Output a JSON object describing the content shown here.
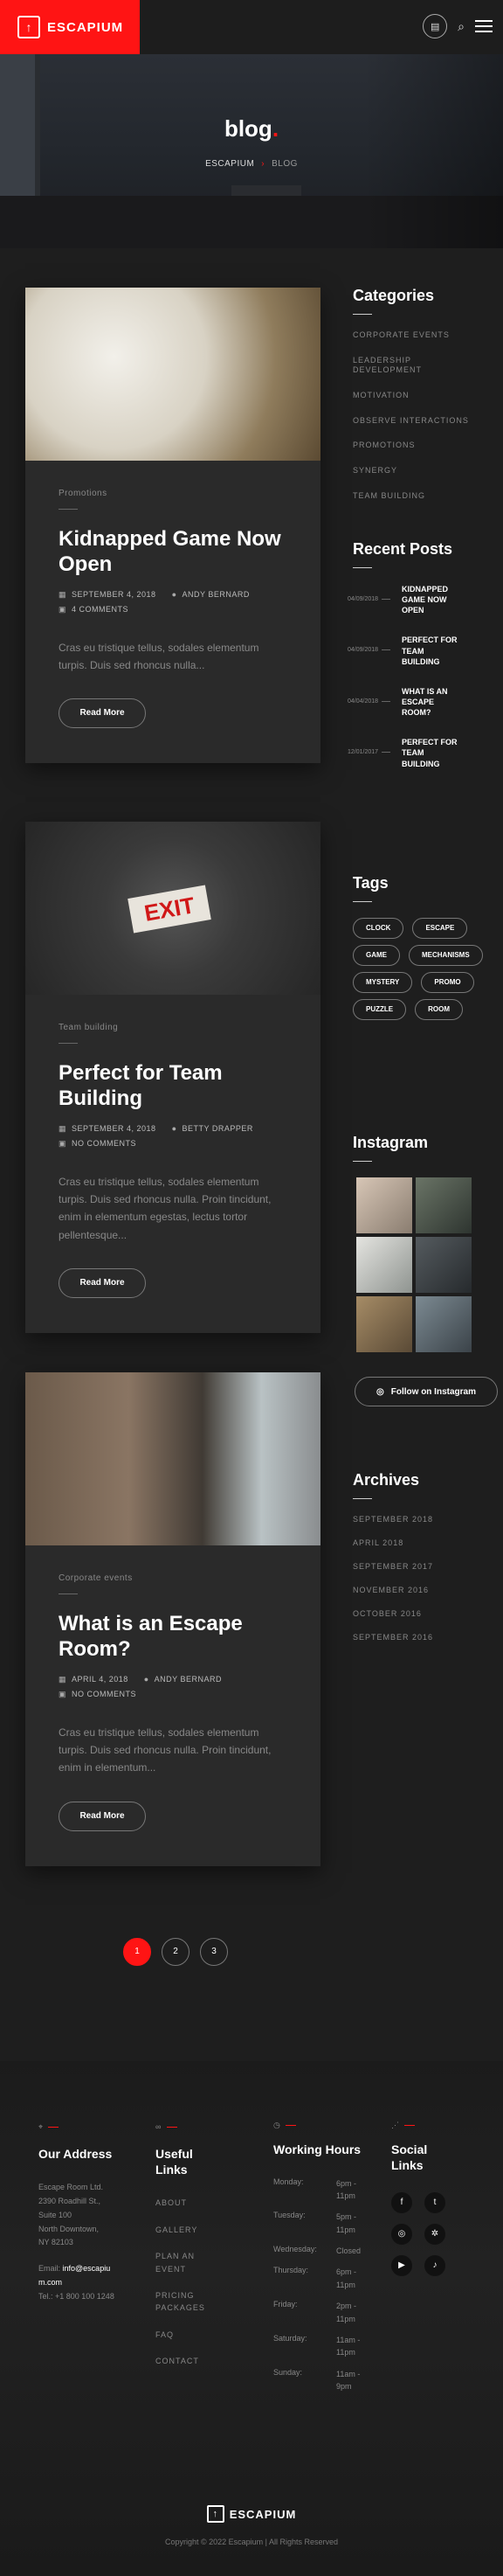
{
  "header": {
    "brand": "ESCAPIUM",
    "logo_glyph": "↑"
  },
  "hero": {
    "title": "blog",
    "crumb_home": "ESCAPIUM",
    "crumb_current": "BLOG"
  },
  "posts": [
    {
      "category": "Promotions",
      "title": "Kidnapped Game Now Open",
      "date": "SEPTEMBER 4, 2018",
      "author": "ANDY BERNARD",
      "comments": "4 COMMENTS",
      "excerpt": "Cras eu tristique tellus, sodales elementum turpis. Duis sed rhoncus nulla...",
      "read_more": "Read More"
    },
    {
      "category": "Team building",
      "title": "Perfect for Team Building",
      "date": "SEPTEMBER 4, 2018",
      "author": "BETTY DRAPPER",
      "comments": "NO COMMENTS",
      "excerpt": "Cras eu tristique tellus, sodales elementum turpis. Duis sed rhoncus nulla. Proin tincidunt, enim in elementum egestas, lectus tortor pellentesque...",
      "read_more": "Read More"
    },
    {
      "category": "Corporate events",
      "title": "What is an Escape Room?",
      "date": "APRIL 4, 2018",
      "author": "ANDY BERNARD",
      "comments": "NO COMMENTS",
      "excerpt": "Cras eu tristique tellus, sodales elementum turpis. Duis sed rhoncus nulla. Proin tincidunt, enim in elementum...",
      "read_more": "Read More"
    }
  ],
  "sidebar": {
    "categories_title": "Categories",
    "categories": [
      "CORPORATE EVENTS",
      "LEADERSHIP DEVELOPMENT",
      "MOTIVATION",
      "OBSERVE INTERACTIONS",
      "PROMOTIONS",
      "SYNERGY",
      "TEAM BUILDING"
    ],
    "recent_title": "Recent Posts",
    "recent": [
      {
        "date": "04/09/2018",
        "title": "KIDNAPPED GAME NOW OPEN"
      },
      {
        "date": "04/09/2018",
        "title": "PERFECT FOR TEAM BUILDING"
      },
      {
        "date": "04/04/2018",
        "title": "WHAT IS AN ESCAPE ROOM?"
      },
      {
        "date": "12/01/2017",
        "title": "PERFECT FOR TEAM BUILDING"
      }
    ],
    "tags_title": "Tags",
    "tags": [
      "CLOCK",
      "ESCAPE",
      "GAME",
      "MECHANISMS",
      "MYSTERY",
      "PROMO",
      "PUZZLE",
      "ROOM"
    ],
    "instagram_title": "Instagram",
    "instagram_follow": "Follow on Instagram",
    "archives_title": "Archives",
    "archives": [
      "SEPTEMBER 2018",
      "APRIL 2018",
      "SEPTEMBER 2017",
      "NOVEMBER 2016",
      "OCTOBER 2016",
      "SEPTEMBER 2016"
    ]
  },
  "pagination": [
    "1",
    "2",
    "3"
  ],
  "footer": {
    "address_title": "Our Address",
    "address_lines": [
      "Escape Room Ltd.",
      "2390 Roadhill St.,",
      "Suite 100",
      "North Downtown,",
      "NY 82103"
    ],
    "email_label": "Email:",
    "email": "info@escapium.com",
    "tel": "Tel.: +1 800 100 1248",
    "links_title": "Useful Links",
    "links": [
      "ABOUT",
      "GALLERY",
      "PLAN AN EVENT",
      "PRICING PACKAGES",
      "FAQ",
      "CONTACT"
    ],
    "hours_title": "Working Hours",
    "hours": [
      {
        "day": "Monday:",
        "time": "6pm - 11pm"
      },
      {
        "day": "Tuesday:",
        "time": "5pm - 11pm"
      },
      {
        "day": "Wednesday:",
        "time": "Closed"
      },
      {
        "day": "Thursday:",
        "time": "6pm - 11pm"
      },
      {
        "day": "Friday:",
        "time": "2pm - 11pm"
      },
      {
        "day": "Saturday:",
        "time": "11am - 11pm"
      },
      {
        "day": "Sunday:",
        "time": "11am - 9pm"
      }
    ],
    "social_title": "Social Links",
    "brand": "ESCAPIUM",
    "copyright": "Copyright © 2022 Escapium | All Rights Reserved"
  }
}
